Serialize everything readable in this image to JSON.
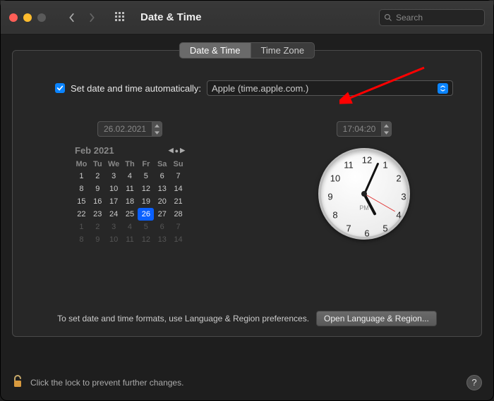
{
  "colors": {
    "close": "#ff5f57",
    "min": "#febc2e",
    "max": "#5a5a5a",
    "accent": "#0a84ff",
    "arrow": "#ff0000"
  },
  "titlebar": {
    "title": "Date & Time",
    "search_placeholder": "Search"
  },
  "tabs": {
    "datetime": "Date & Time",
    "timezone": "Time Zone",
    "active": "datetime"
  },
  "auto": {
    "checked": true,
    "label": "Set date and time automatically:",
    "server": "Apple (time.apple.com.)"
  },
  "date": {
    "value": "26.02.2021"
  },
  "time": {
    "value": "17:04:20",
    "ampm": "PM"
  },
  "clock": {
    "hour": 17,
    "minute": 4,
    "second": 20,
    "numbers": [
      "12",
      "1",
      "2",
      "3",
      "4",
      "5",
      "6",
      "7",
      "8",
      "9",
      "10",
      "11"
    ]
  },
  "calendar": {
    "title": "Feb 2021",
    "dow": [
      "Mo",
      "Tu",
      "We",
      "Th",
      "Fr",
      "Sa",
      "Su"
    ],
    "weeks": [
      [
        {
          "d": "1"
        },
        {
          "d": "2"
        },
        {
          "d": "3"
        },
        {
          "d": "4"
        },
        {
          "d": "5"
        },
        {
          "d": "6"
        },
        {
          "d": "7"
        }
      ],
      [
        {
          "d": "8"
        },
        {
          "d": "9"
        },
        {
          "d": "10"
        },
        {
          "d": "11"
        },
        {
          "d": "12"
        },
        {
          "d": "13"
        },
        {
          "d": "14"
        }
      ],
      [
        {
          "d": "15"
        },
        {
          "d": "16"
        },
        {
          "d": "17"
        },
        {
          "d": "18"
        },
        {
          "d": "19"
        },
        {
          "d": "20"
        },
        {
          "d": "21"
        }
      ],
      [
        {
          "d": "22"
        },
        {
          "d": "23"
        },
        {
          "d": "24"
        },
        {
          "d": "25"
        },
        {
          "d": "26",
          "sel": true
        },
        {
          "d": "27"
        },
        {
          "d": "28"
        }
      ],
      [
        {
          "d": "1",
          "other": true
        },
        {
          "d": "2",
          "other": true
        },
        {
          "d": "3",
          "other": true
        },
        {
          "d": "4",
          "other": true
        },
        {
          "d": "5",
          "other": true
        },
        {
          "d": "6",
          "other": true
        },
        {
          "d": "7",
          "other": true
        }
      ],
      [
        {
          "d": "8",
          "other": true
        },
        {
          "d": "9",
          "other": true
        },
        {
          "d": "10",
          "other": true
        },
        {
          "d": "11",
          "other": true
        },
        {
          "d": "12",
          "other": true
        },
        {
          "d": "13",
          "other": true
        },
        {
          "d": "14",
          "other": true
        }
      ]
    ]
  },
  "footer": {
    "hint": "To set date and time formats, use Language & Region preferences.",
    "button": "Open Language & Region..."
  },
  "lock": {
    "text": "Click the lock to prevent further changes."
  },
  "help": {
    "label": "?"
  }
}
